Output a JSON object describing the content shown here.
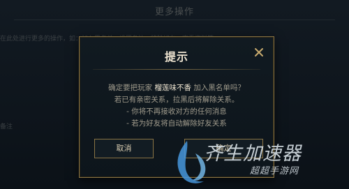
{
  "background": {
    "title": "更多操作",
    "line1": "在此处进行更多的操作，如：加入黑名单、设置备注、移除好友、查看资料等",
    "line2": "备注"
  },
  "dialog": {
    "title": "提示",
    "message_prefix": "确定要把玩家",
    "player_name": "榴莲味不香",
    "message_suffix": "加入黑名单吗？",
    "line2": "若已有亲密关系，拉黑后将解除关系。",
    "line3": "- 你将不再接收对方的任何消息",
    "line4": "- 若为好友将自动解除好友关系",
    "cancel_label": "取消",
    "confirm_label": "确定"
  },
  "watermark": {
    "brand": "齐生加速器",
    "sub": "超超手游网"
  },
  "colors": {
    "accent_gold": "#c8aa6e",
    "border_gold": "#8a7444",
    "title_text": "#f0e6d2",
    "body_text": "#a09b8c"
  }
}
